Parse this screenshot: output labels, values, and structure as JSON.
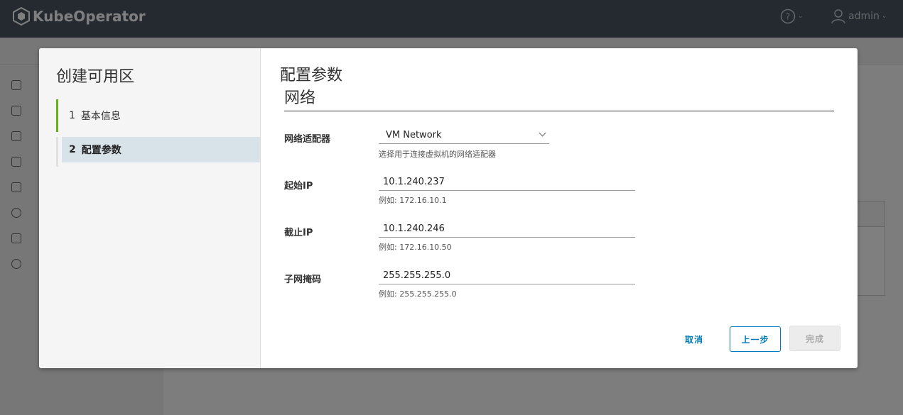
{
  "app": {
    "name": "KubeOperator",
    "user": "admin"
  },
  "wizard": {
    "title": "创建可用区",
    "steps": [
      {
        "num": "1",
        "label": "基本信息"
      },
      {
        "num": "2",
        "label": "配置参数"
      }
    ]
  },
  "main": {
    "title": "配置参数",
    "section": "网络",
    "fields": {
      "adapter": {
        "label": "网络适配器",
        "value": "VM Network",
        "helper": "选择用于连接虚拟机的网络适配器"
      },
      "start_ip": {
        "label": "起始IP",
        "value": "10.1.240.237",
        "helper": "例如: 172.16.10.1"
      },
      "end_ip": {
        "label": "截止IP",
        "value": "10.1.240.246",
        "helper": "例如: 172.16.10.50"
      },
      "netmask": {
        "label": "子网掩码",
        "value": "255.255.255.0",
        "helper": "例如: 255.255.255.0"
      }
    }
  },
  "buttons": {
    "cancel": "取消",
    "prev": "上一步",
    "finish": "完成"
  },
  "colors": {
    "topbar": "#485460",
    "accent": "#0079b8",
    "step_done": "#60b515",
    "active_step_bg": "#d8e3e9"
  },
  "icons": [
    "kubeoperator-logo-icon",
    "help-icon",
    "user-icon",
    "chevron-down-icon"
  ]
}
